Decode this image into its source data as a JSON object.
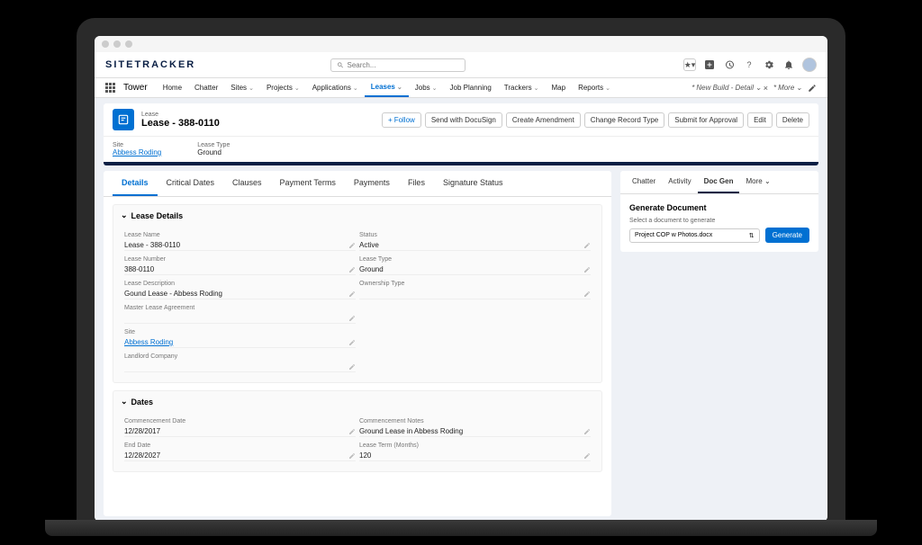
{
  "app": {
    "logo": "SITETRACKER",
    "search_placeholder": "Search..."
  },
  "nav": {
    "title": "Tower",
    "items": [
      {
        "label": "Home",
        "dropdown": false
      },
      {
        "label": "Chatter",
        "dropdown": false
      },
      {
        "label": "Sites",
        "dropdown": true
      },
      {
        "label": "Projects",
        "dropdown": true
      },
      {
        "label": "Applications",
        "dropdown": true
      },
      {
        "label": "Leases",
        "dropdown": true,
        "active": true
      },
      {
        "label": "Jobs",
        "dropdown": true
      },
      {
        "label": "Job Planning",
        "dropdown": false
      },
      {
        "label": "Trackers",
        "dropdown": true
      },
      {
        "label": "Map",
        "dropdown": false
      },
      {
        "label": "Reports",
        "dropdown": true
      }
    ],
    "right": {
      "open_tab": "New Build - Detail",
      "more": "More"
    }
  },
  "record": {
    "type": "Lease",
    "title": "Lease - 388-0110",
    "actions": [
      "Follow",
      "Send with DocuSign",
      "Create Amendment",
      "Change Record Type",
      "Submit for Approval",
      "Edit",
      "Delete"
    ],
    "header_fields": [
      {
        "label": "Site",
        "value": "Abbess Roding",
        "link": true
      },
      {
        "label": "Lease Type",
        "value": "Ground"
      }
    ]
  },
  "left_tabs": [
    "Details",
    "Critical Dates",
    "Clauses",
    "Payment Terms",
    "Payments",
    "Files",
    "Signature Status"
  ],
  "sections": {
    "lease_details": {
      "title": "Lease Details",
      "rows": [
        [
          {
            "label": "Lease Name",
            "value": "Lease - 388-0110"
          },
          {
            "label": "Status",
            "value": "Active"
          }
        ],
        [
          {
            "label": "Lease Number",
            "value": "388-0110"
          },
          {
            "label": "Lease Type",
            "value": "Ground"
          }
        ],
        [
          {
            "label": "Lease Description",
            "value": "Gound Lease - Abbess Roding"
          },
          {
            "label": "Ownership Type",
            "value": ""
          }
        ],
        [
          {
            "label": "Master Lease Agreement",
            "value": ""
          },
          null
        ],
        [
          {
            "label": "Site",
            "value": "Abbess Roding",
            "link": true
          },
          null
        ],
        [
          {
            "label": "Landlord Company",
            "value": ""
          },
          null
        ]
      ]
    },
    "dates": {
      "title": "Dates",
      "rows": [
        [
          {
            "label": "Commencement Date",
            "value": "12/28/2017"
          },
          {
            "label": "Commencement Notes",
            "value": "Ground Lease in Abbess Roding"
          }
        ],
        [
          {
            "label": "End Date",
            "value": "12/28/2027"
          },
          {
            "label": "Lease Term (Months)",
            "value": "120"
          }
        ]
      ]
    }
  },
  "right_tabs": [
    "Chatter",
    "Activity",
    "Doc Gen",
    "More"
  ],
  "docgen": {
    "title": "Generate Document",
    "hint": "Select a document to generate",
    "selected": "Project COP w Photos.docx",
    "button": "Generate"
  }
}
